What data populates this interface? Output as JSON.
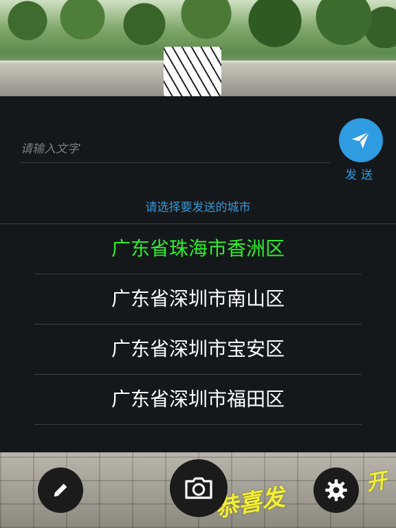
{
  "input": {
    "placeholder": "请输入文字",
    "value": ""
  },
  "send": {
    "label": "发送",
    "icon": "paper-plane-icon",
    "color": "#2f9be0"
  },
  "prompt": "请选择要发送的城市",
  "cities": [
    {
      "label": "广东省珠海市香洲区",
      "selected": true
    },
    {
      "label": "广东省深圳市南山区",
      "selected": false
    },
    {
      "label": "广东省深圳市宝安区",
      "selected": false
    },
    {
      "label": "广东省深圳市福田区",
      "selected": false
    }
  ],
  "colors": {
    "accent": "#2f9be0",
    "selected": "#2ef02e",
    "panel": "#15181b"
  },
  "controls": {
    "left_icon": "pencil-icon",
    "center_icon": "camera-icon",
    "right_icon": "gear-icon"
  },
  "overlay_text": {
    "primary": "恭喜发",
    "secondary": "开"
  }
}
